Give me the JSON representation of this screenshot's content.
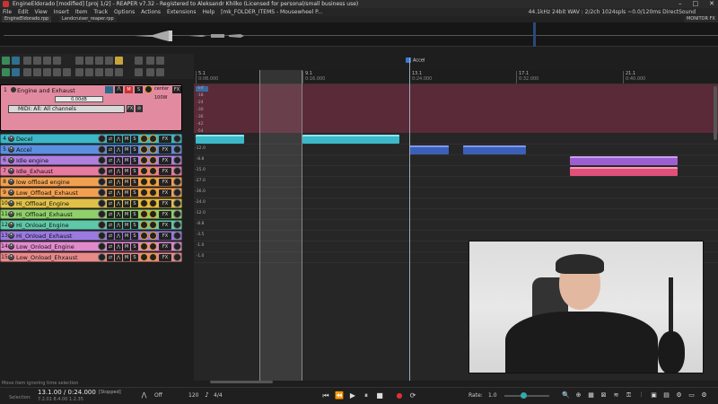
{
  "window": {
    "title": "EngineEldorado [modified] [proj 1/2] - REAPER v7.32 - Registered to Aleksandr Khilko (Licensed for personal/small business use)",
    "controls": [
      "–",
      "□",
      "✕"
    ]
  },
  "menu": {
    "items": [
      "File",
      "Edit",
      "View",
      "Insert",
      "Item",
      "Track",
      "Options",
      "Actions",
      "Extensions",
      "Help",
      "[mk_FOLDER_ITEMS - Mousewheel P..."
    ],
    "status": "44.1kHz 24bit WAV : 2/2ch 1024spls ~0.0/120ms DirectSound"
  },
  "project_tabs": [
    "EngineEldorado.rpp",
    "Landcruiser_reaper.rpp"
  ],
  "monitor_label": "MONITOR FX",
  "ruler": {
    "marks": [
      {
        "bar": "5.1",
        "time": "0:08.000"
      },
      {
        "bar": "9.1",
        "time": "0:16.000"
      },
      {
        "bar": "13.1",
        "time": "0:24.000"
      },
      {
        "bar": "17.1",
        "time": "0:32.000"
      },
      {
        "bar": "21.1",
        "time": "0:40.000"
      }
    ],
    "marker_name": "Accel"
  },
  "master_track": {
    "number": "1",
    "name": "Engine and Exhaust",
    "volume": "0.00dB",
    "pan": "center",
    "width": "100W",
    "midi": "MIDI: All: All channels",
    "scale": [
      "-inf",
      "-18",
      "-24",
      "-30",
      "-36",
      "-42",
      "-54"
    ]
  },
  "tracks": [
    {
      "num": "4",
      "name": "Decel",
      "color": "#3cb8c8"
    },
    {
      "num": "5",
      "name": "Accel",
      "color": "#5b8fe0"
    },
    {
      "num": "6",
      "name": "Idle engine",
      "color": "#b07fe0"
    },
    {
      "num": "7",
      "name": "Idle_Exhaust",
      "color": "#e87aa0"
    },
    {
      "num": "8",
      "name": "low offload engine",
      "color": "#f2a050"
    },
    {
      "num": "9",
      "name": "Low_Offload_Exhaust",
      "color": "#f2a050"
    },
    {
      "num": "10",
      "name": "Hi_Offload_Engine",
      "color": "#e0c048"
    },
    {
      "num": "11",
      "name": "Hi_Offload_Exhaust",
      "color": "#8fd06a"
    },
    {
      "num": "12",
      "name": "Hi_Onload_Engine",
      "color": "#5fc8a8"
    },
    {
      "num": "13",
      "name": "Hi_Onload_Exhaust",
      "color": "#9a7ae0"
    },
    {
      "num": "14",
      "name": "Low_Onload_Engine",
      "color": "#e08acb"
    },
    {
      "num": "15",
      "name": "Low_Onload_Ehxaust",
      "color": "#e88a8a"
    }
  ],
  "track_buttons": {
    "mute": "M",
    "solo": "S",
    "fx": "FX"
  },
  "lane_scale": [
    "-24.0",
    "-12.0",
    "-8.8",
    "-15.0",
    "-27.0",
    "-36.0",
    "-24.0",
    "-12.0",
    "-8.8",
    "-3.5",
    "-1.0",
    "-1.0"
  ],
  "hint": "Move item ignoring time selection",
  "transport": {
    "selection_label": "Selection:",
    "position": "13.1.00 / 0:24.000",
    "position_sub": "7.2.01   8.4.00   1.2.35",
    "state": "[Stopped]",
    "off_label": "Off",
    "bpm": "120",
    "timesig": "4/4",
    "rate_label": "Rate:",
    "rate": "1.0"
  },
  "colors": {
    "master": "#e28aa0",
    "master_lane": "#5a2a38",
    "accent": "#3a8a5a"
  }
}
